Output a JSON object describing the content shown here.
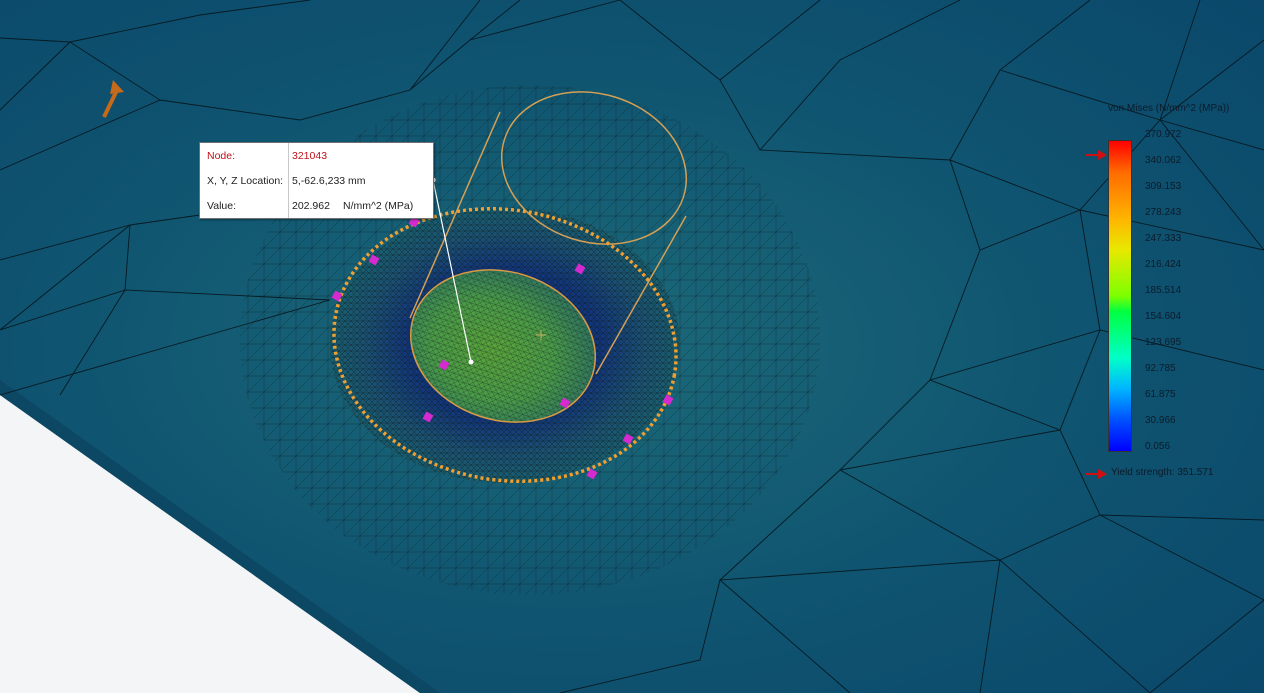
{
  "probe": {
    "node_label": "Node:",
    "node_value": "321043",
    "location_label": "X, Y, Z Location:",
    "location_value": "5,-62.6,233 mm",
    "value_label": "Value:",
    "value_number": "202.962",
    "value_unit": "N/mm^2 (MPa)"
  },
  "legend": {
    "title": "von Mises (N/mm^2 (MPa))",
    "ticks": [
      "370.972",
      "340.062",
      "309.153",
      "278.243",
      "247.333",
      "216.424",
      "185.514",
      "154.604",
      "123.695",
      "92.785",
      "61.875",
      "30.966",
      "0.056"
    ],
    "yield_label": "Yield strength: 351.571",
    "colors": {
      "max": "#ff0000",
      "mid": "#00ff40",
      "min": "#0000ff"
    }
  },
  "icons": [
    "triad-arrow-icon",
    "probe-pin-icon",
    "legend-pointer-icon"
  ]
}
